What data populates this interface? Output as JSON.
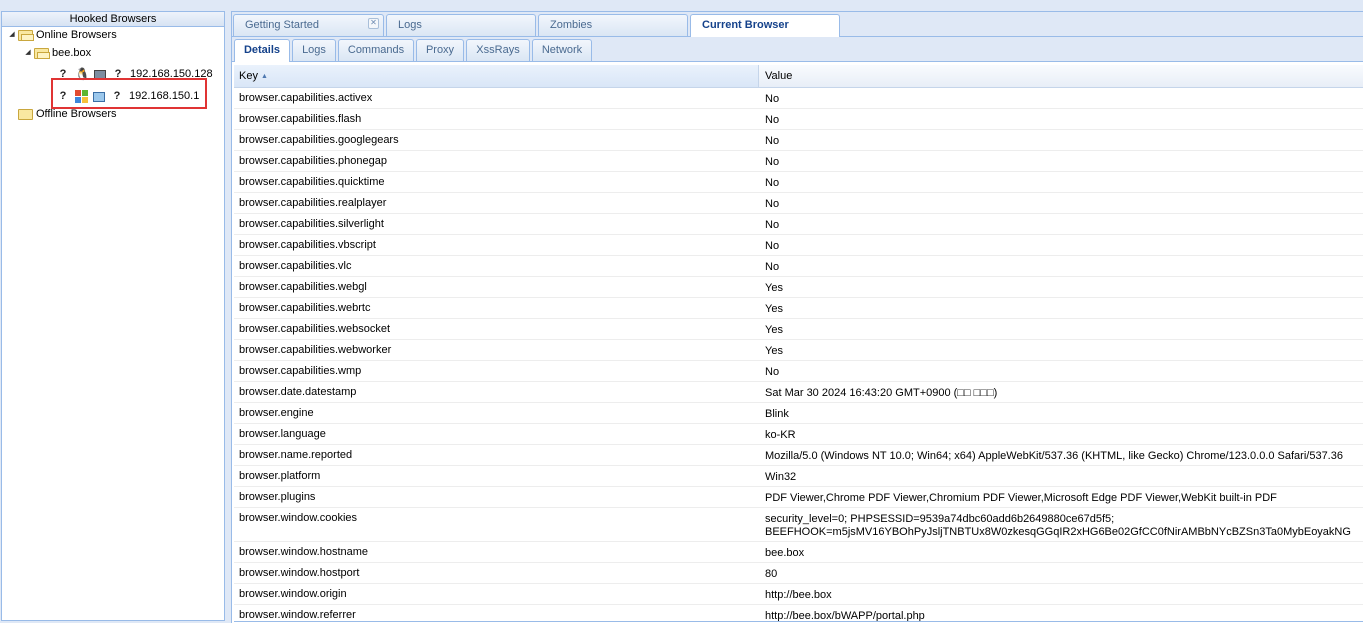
{
  "left_panel": {
    "title": "Hooked Browsers",
    "online_label": "Online Browsers",
    "group_label": "bee.box",
    "browsers": [
      {
        "ip": "192.168.150.128",
        "icons": [
          "question-icon",
          "linux-icon",
          "monitor-icon",
          "question-icon"
        ]
      },
      {
        "ip": "192.168.150.1",
        "icons": [
          "question-icon",
          "windows-icon",
          "desktop-icon",
          "question-icon"
        ]
      }
    ],
    "offline_label": "Offline Browsers"
  },
  "top_tabs": [
    {
      "label": "Getting Started",
      "closable": true
    },
    {
      "label": "Logs"
    },
    {
      "label": "Zombies"
    },
    {
      "label": "Current Browser",
      "active": true
    }
  ],
  "sub_tabs": [
    {
      "label": "Details",
      "active": true
    },
    {
      "label": "Logs"
    },
    {
      "label": "Commands"
    },
    {
      "label": "Proxy"
    },
    {
      "label": "XssRays"
    },
    {
      "label": "Network"
    }
  ],
  "grid": {
    "columns": {
      "key": "Key",
      "value": "Value"
    },
    "rows": [
      {
        "key": "browser.capabilities.activex",
        "value": "No"
      },
      {
        "key": "browser.capabilities.flash",
        "value": "No"
      },
      {
        "key": "browser.capabilities.googlegears",
        "value": "No"
      },
      {
        "key": "browser.capabilities.phonegap",
        "value": "No"
      },
      {
        "key": "browser.capabilities.quicktime",
        "value": "No"
      },
      {
        "key": "browser.capabilities.realplayer",
        "value": "No"
      },
      {
        "key": "browser.capabilities.silverlight",
        "value": "No"
      },
      {
        "key": "browser.capabilities.vbscript",
        "value": "No"
      },
      {
        "key": "browser.capabilities.vlc",
        "value": "No"
      },
      {
        "key": "browser.capabilities.webgl",
        "value": "Yes"
      },
      {
        "key": "browser.capabilities.webrtc",
        "value": "Yes"
      },
      {
        "key": "browser.capabilities.websocket",
        "value": "Yes"
      },
      {
        "key": "browser.capabilities.webworker",
        "value": "Yes"
      },
      {
        "key": "browser.capabilities.wmp",
        "value": "No"
      },
      {
        "key": "browser.date.datestamp",
        "value": "Sat Mar 30 2024 16:43:20 GMT+0900 (□□ □□□)"
      },
      {
        "key": "browser.engine",
        "value": "Blink"
      },
      {
        "key": "browser.language",
        "value": "ko-KR"
      },
      {
        "key": "browser.name.reported",
        "value": "Mozilla/5.0 (Windows NT 10.0; Win64; x64) AppleWebKit/537.36 (KHTML, like Gecko) Chrome/123.0.0.0 Safari/537.36"
      },
      {
        "key": "browser.platform",
        "value": "Win32"
      },
      {
        "key": "browser.plugins",
        "value": "PDF Viewer,Chrome PDF Viewer,Chromium PDF Viewer,Microsoft Edge PDF Viewer,WebKit built-in PDF"
      },
      {
        "key": "browser.window.cookies",
        "value": "security_level=0; PHPSESSID=9539a74dbc60add6b2649880ce67d5f5;\nBEEFHOOK=m5jsMV16YBOhPyJsljTNBTUx8W0zkesqGGqIR2xHG6Be02GfCC0fNirAMBbNYcBZSn3Ta0MybEoyakNG",
        "tall": true
      },
      {
        "key": "browser.window.hostname",
        "value": "bee.box"
      },
      {
        "key": "browser.window.hostport",
        "value": "80"
      },
      {
        "key": "browser.window.origin",
        "value": "http://bee.box"
      },
      {
        "key": "browser.window.referrer",
        "value": "http://bee.box/bWAPP/portal.php"
      }
    ]
  },
  "colors": {
    "accent": "#15428b",
    "border": "#99bbe8",
    "highlight": "#e03434"
  }
}
